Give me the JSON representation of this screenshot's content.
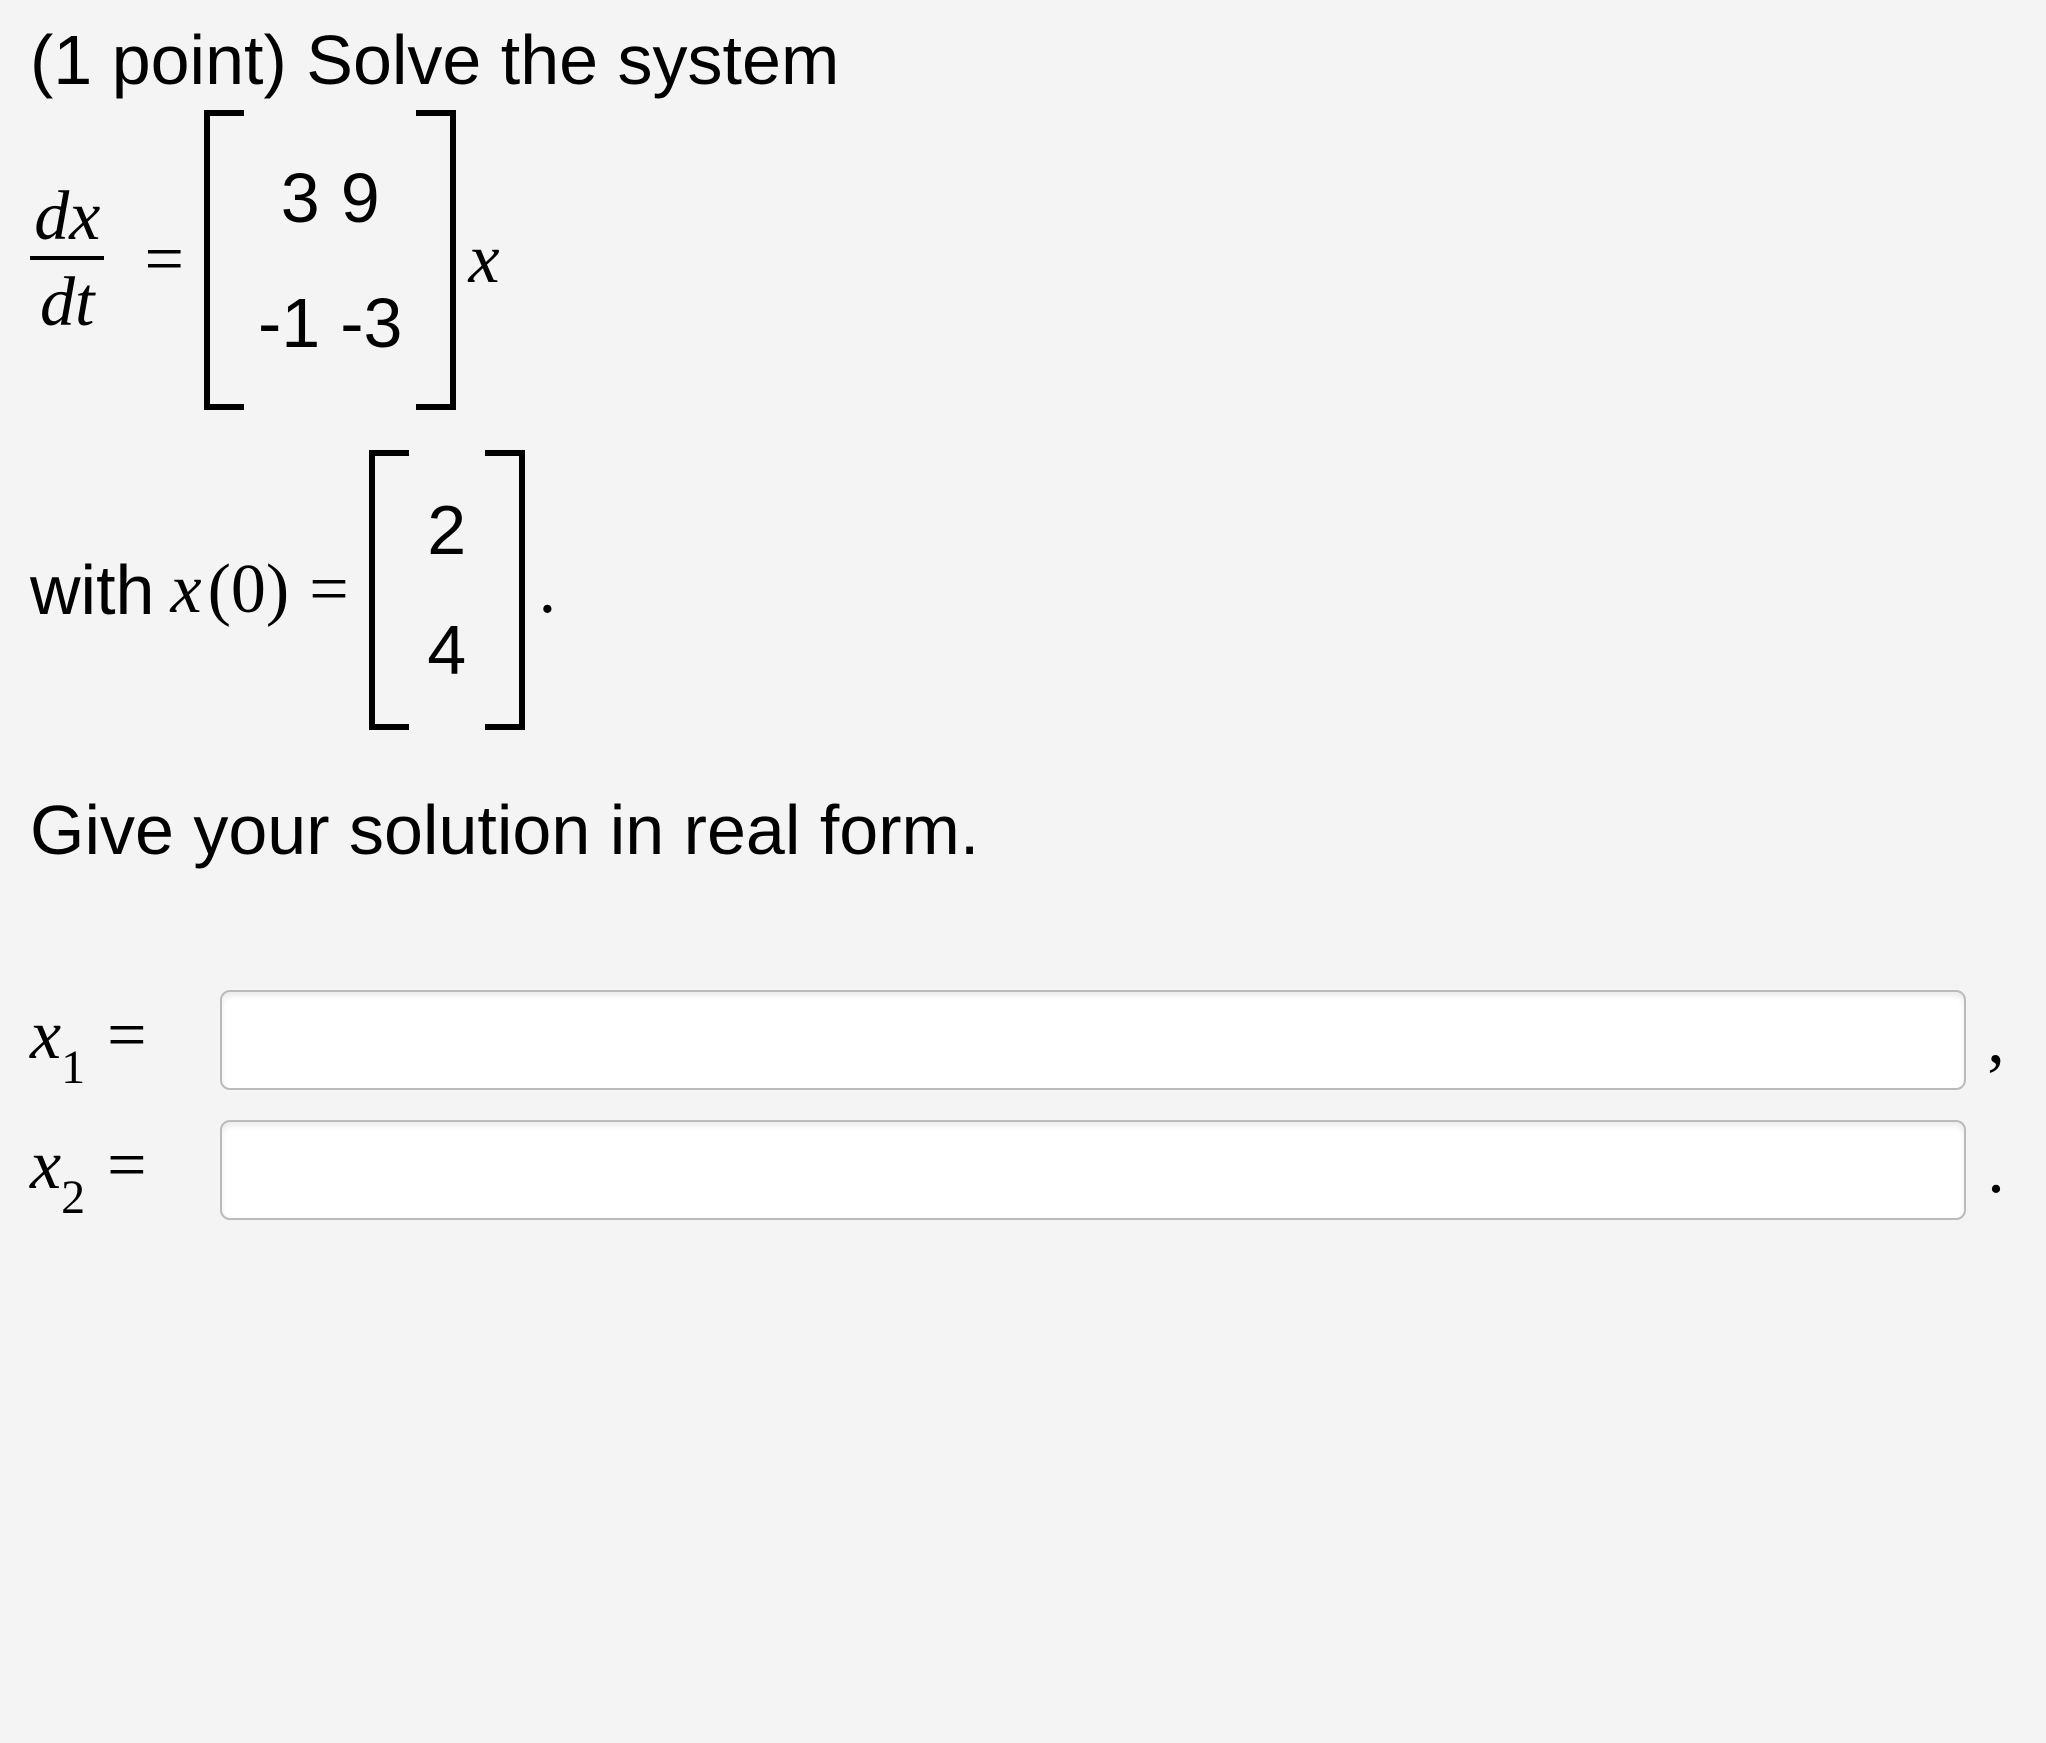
{
  "problem": {
    "points_label": "(1 point) ",
    "prompt_text": "Solve the system",
    "lhs_numerator": "dx",
    "lhs_denominator": "dt",
    "equals": "=",
    "matrix_A": {
      "r1c1": "3",
      "r1c2": "9",
      "r2c1": "-1",
      "r2c2": "-3"
    },
    "vector_var": "x",
    "with_label": "with ",
    "ic_var": "x",
    "ic_arg": "(0)",
    "ic_vector": {
      "r1": "2",
      "r2": "4"
    },
    "ic_period": ".",
    "instruction": "Give your solution in real form."
  },
  "answers": {
    "x1_label_var": "x",
    "x1_label_sub": "1",
    "x1_equals": " = ",
    "x1_value": "",
    "x1_trail": ",",
    "x2_label_var": "x",
    "x2_label_sub": "2",
    "x2_equals": " = ",
    "x2_value": "",
    "x2_trail": "."
  }
}
